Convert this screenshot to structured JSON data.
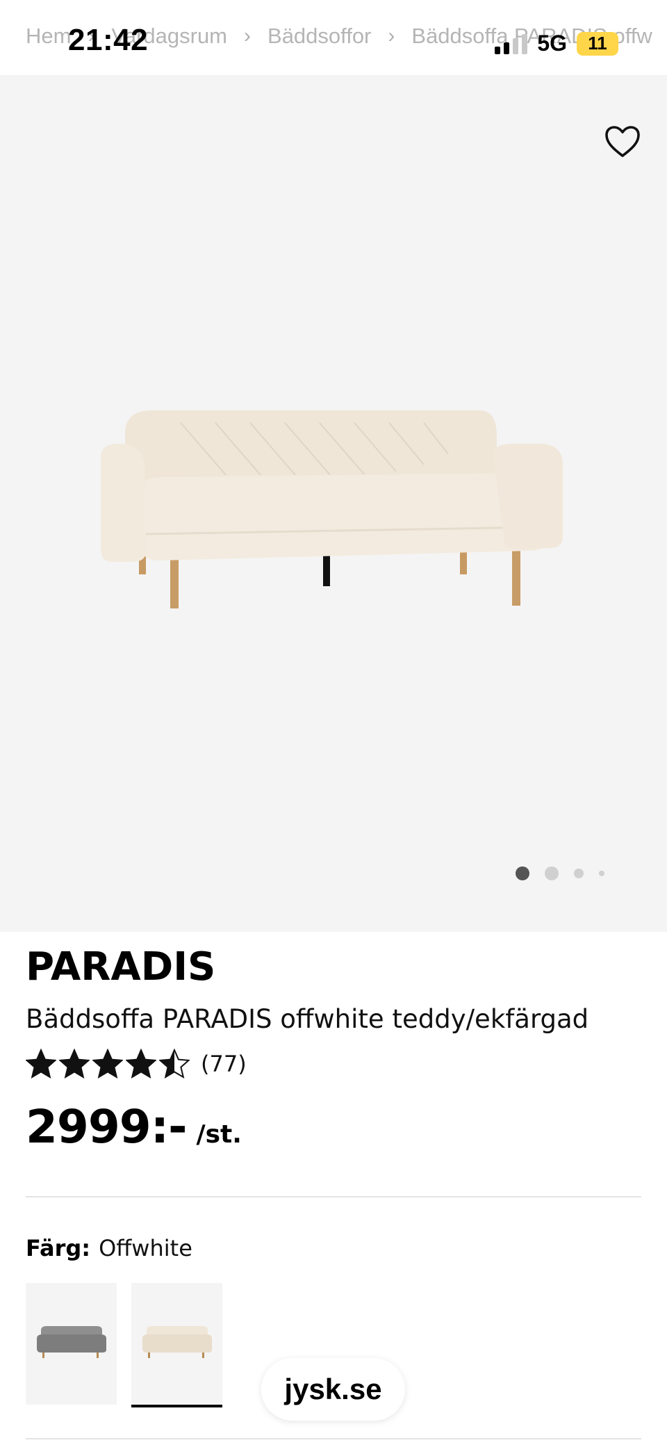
{
  "status_bar": {
    "time": "21:42",
    "network": "5G",
    "battery": "11",
    "battery_color": "#ffd54a"
  },
  "breadcrumb": {
    "items": [
      "Hem",
      "Vardagsrum",
      "Bäddsoffor",
      "Bäddsoffa PARADIS offw"
    ],
    "separator": "›"
  },
  "gallery": {
    "background_color": "#f4f4f4",
    "favorite_icon": "heart-icon",
    "image_count": 4,
    "active_index": 0
  },
  "product": {
    "brand": "PARADIS",
    "name": "Bäddsoffa PARADIS offwhite teddy/ekfärgad",
    "rating_value": 4.5,
    "rating_max": 5,
    "rating_count": "(77)",
    "price": "2999:-",
    "price_unit": "/st."
  },
  "color": {
    "label": "Färg:",
    "value": "Offwhite",
    "options": [
      {
        "name": "grey",
        "color": "#8a8a8a",
        "selected": false
      },
      {
        "name": "offwhite",
        "color": "#efe6da",
        "selected": true
      }
    ]
  },
  "url_pill": "jysk.se"
}
